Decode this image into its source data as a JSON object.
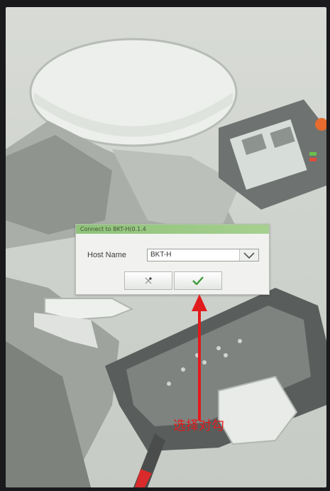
{
  "dialog": {
    "title": "Connect to BKT-H(0.1.4",
    "host_label": "Host Name",
    "host_value": "BKT-H"
  },
  "buttons": {
    "cancel_icon": "cancel-icon",
    "confirm_icon": "checkmark-icon"
  },
  "annotation": {
    "label": "选择对勾",
    "color": "#e11b1b"
  },
  "colors": {
    "title_bar": "#9ccb86",
    "confirm_check": "#3f9a3a"
  }
}
